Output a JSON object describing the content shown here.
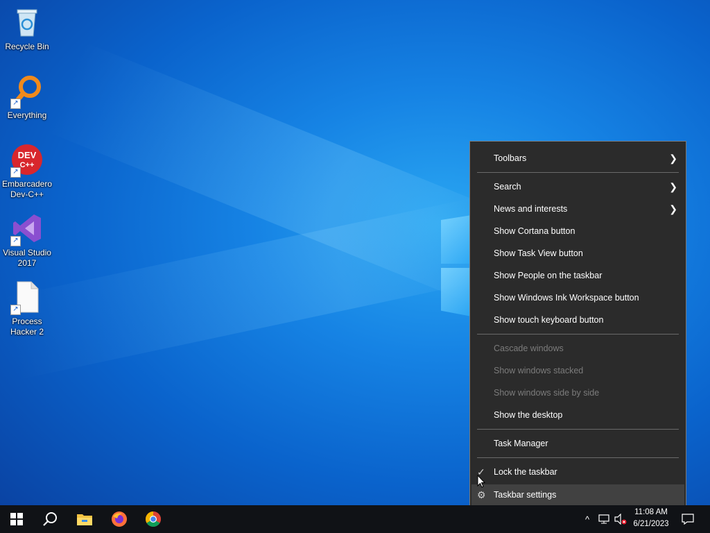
{
  "desktop": {
    "icons": [
      {
        "label": "Recycle Bin"
      },
      {
        "label": "Everything"
      },
      {
        "label": "Embarcadero Dev-C++"
      },
      {
        "label": "Visual Studio 2017"
      },
      {
        "label": "Process Hacker 2"
      }
    ],
    "devcpp_logo_text": "DEV",
    "devcpp_logo_sub": "C++"
  },
  "context_menu": {
    "items": [
      {
        "label": "Toolbars",
        "submenu": true
      },
      {
        "label": "Search",
        "submenu": true
      },
      {
        "label": "News and interests",
        "submenu": true
      },
      {
        "label": "Show Cortana button"
      },
      {
        "label": "Show Task View button"
      },
      {
        "label": "Show People on the taskbar"
      },
      {
        "label": "Show Windows Ink Workspace button"
      },
      {
        "label": "Show touch keyboard button"
      },
      {
        "label": "Cascade windows",
        "disabled": true
      },
      {
        "label": "Show windows stacked",
        "disabled": true
      },
      {
        "label": "Show windows side by side",
        "disabled": true
      },
      {
        "label": "Show the desktop"
      },
      {
        "label": "Task Manager"
      },
      {
        "label": "Lock the taskbar",
        "checked": true
      },
      {
        "label": "Taskbar settings",
        "icon": "gear-icon",
        "highlighted": true
      }
    ]
  },
  "taskbar": {
    "pinned": [
      "start-icon",
      "search-icon",
      "file-explorer-icon",
      "firefox-icon",
      "chrome-icon"
    ],
    "tray": {
      "chevron": "^",
      "time": "11:08 AM",
      "date": "6/21/2023"
    }
  },
  "colors": {
    "menu_bg": "#2b2b2b",
    "menu_disabled": "#7c7c7c",
    "menu_highlight": "#414141",
    "taskbar_bg": "#101216"
  }
}
